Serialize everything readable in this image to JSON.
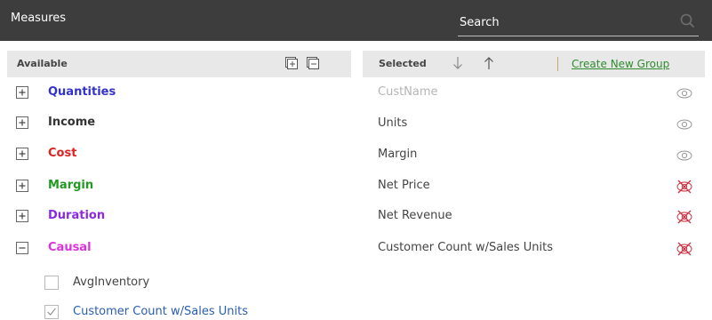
{
  "header": {
    "title": "Measures",
    "search_placeholder": "Search",
    "search_icon": "search-icon"
  },
  "available": {
    "label": "Available",
    "expand_all_icon": "expand-all-icon",
    "collapse_all_icon": "collapse-all-icon",
    "groups": [
      {
        "label": "Quantities",
        "color": "#3333cc",
        "state": "collapsed"
      },
      {
        "label": "Income",
        "color": "#333333",
        "state": "collapsed"
      },
      {
        "label": "Cost",
        "color": "#dd2222",
        "state": "collapsed"
      },
      {
        "label": "Margin",
        "color": "#229922",
        "state": "collapsed"
      },
      {
        "label": "Duration",
        "color": "#8a2be2",
        "state": "collapsed"
      },
      {
        "label": "Causal",
        "color": "#dd33dd",
        "state": "expanded"
      }
    ],
    "causal_items": [
      {
        "label": "AvgInventory",
        "checked": false,
        "color": "#444444"
      },
      {
        "label": "Customer Count w/Sales Units",
        "checked": true,
        "color": "#2a5db0"
      }
    ]
  },
  "selected": {
    "label": "Selected",
    "sort_down_icon": "arrow-down-icon",
    "sort_up_icon": "arrow-up-icon",
    "create_group_label": "Create New Group",
    "items": [
      {
        "label": "CustName",
        "dimmed": true,
        "visibility": "visible"
      },
      {
        "label": "Units",
        "dimmed": false,
        "visibility": "visible"
      },
      {
        "label": "Margin",
        "dimmed": false,
        "visibility": "visible"
      },
      {
        "label": "Net Price",
        "dimmed": false,
        "visibility": "hidden"
      },
      {
        "label": "Net Revenue",
        "dimmed": false,
        "visibility": "hidden"
      },
      {
        "label": "Customer Count w/Sales Units",
        "dimmed": false,
        "visibility": "hidden"
      }
    ]
  },
  "colors": {
    "header_bg": "#3d3d3d",
    "panel_header_bg": "#e8e8e8",
    "link_green": "#2e8b2e",
    "hidden_eye_red": "#cc3344",
    "visible_eye_gray": "#9a9a9a"
  }
}
